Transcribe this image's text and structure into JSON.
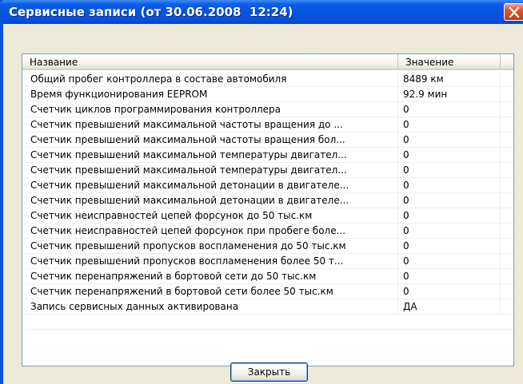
{
  "window": {
    "title": "Сервисные записи (от 30.06.2008  12:24)"
  },
  "columns": {
    "name": "Название",
    "value": "Значение"
  },
  "rows": [
    {
      "name": "Общий пробег контроллера в составе автомобиля",
      "value": "8489 км"
    },
    {
      "name": "Время функционирования EEPROM",
      "value": "92.9 мин"
    },
    {
      "name": "Счетчик циклов программирования контроллера",
      "value": "0"
    },
    {
      "name": "Счетчик превышений максимальной частоты вращения до ...",
      "value": "0"
    },
    {
      "name": "Счетчик превышений максимальной частоты вращения бол...",
      "value": "0"
    },
    {
      "name": "Счетчик превышений максимальной температуры двигател...",
      "value": "0"
    },
    {
      "name": "Счетчик превышений максимальной температуры двигател...",
      "value": "0"
    },
    {
      "name": "Счетчик превышений максимальной детонации в двигателе...",
      "value": "0"
    },
    {
      "name": "Счетчик превышений максимальной детонации в двигателе...",
      "value": "0"
    },
    {
      "name": "Счетчик неисправностей цепей форсунок до 50 тыс.км",
      "value": "0"
    },
    {
      "name": "Счетчик неисправностей цепей форсунок при пробеге боле...",
      "value": "0"
    },
    {
      "name": "Счетчик превышений пропусков воспламенения до 50 тыс.км",
      "value": "0"
    },
    {
      "name": "Счетчик превышений пропусков воспламенения более 50 т...",
      "value": "0"
    },
    {
      "name": "Счетчик перенапряжений в бортовой сети до 50 тыс.км",
      "value": "0"
    },
    {
      "name": "Счетчик перенапряжений в бортовой сети более 50 тыс.км",
      "value": "0"
    },
    {
      "name": "Запись сервисных данных активирована",
      "value": "ДА"
    }
  ],
  "buttons": {
    "close_label": "Закрыть"
  },
  "icons": {
    "title_close": "close-icon"
  },
  "colors": {
    "titlebar": "#0554e3",
    "close_button": "#e2552f",
    "dialog_bg": "#ece9d8"
  }
}
